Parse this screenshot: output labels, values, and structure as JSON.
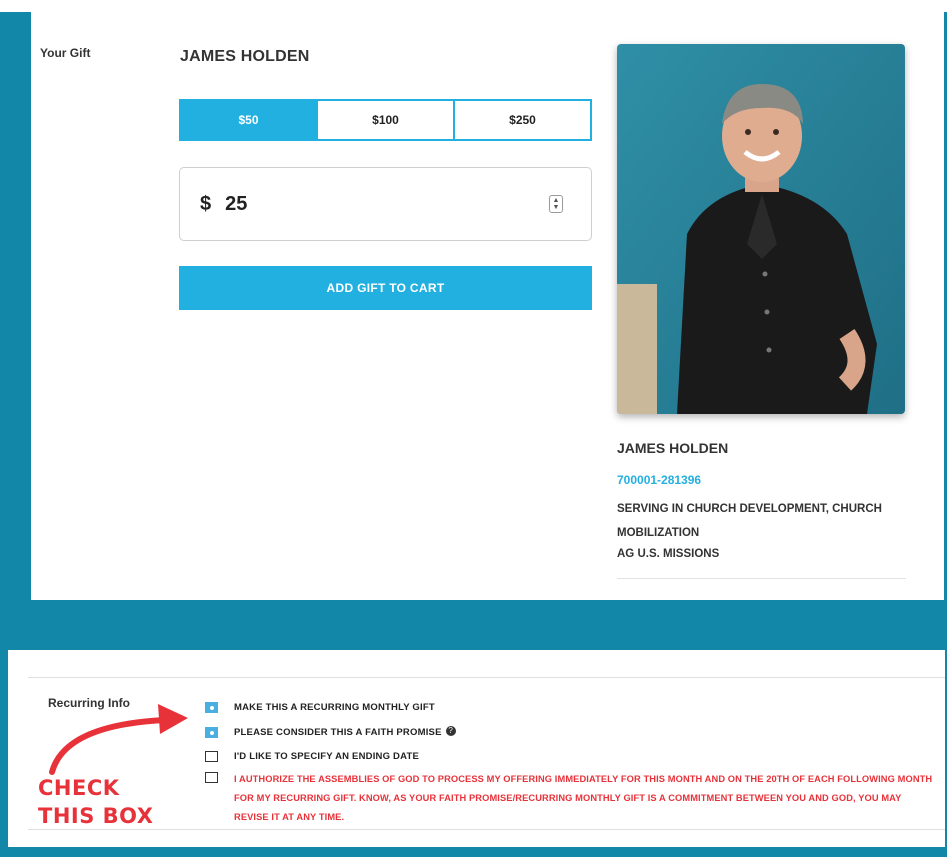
{
  "gift": {
    "section_label": "Your Gift",
    "recipient_name": "JAMES HOLDEN",
    "amount_options": [
      "$50",
      "$100",
      "$250"
    ],
    "selected_option": "$50",
    "currency_symbol": "$",
    "custom_amount": "25",
    "add_to_cart_label": "ADD GIFT TO CART"
  },
  "profile": {
    "name": "JAMES HOLDEN",
    "account_number": "700001-281396",
    "serving": "SERVING IN CHURCH DEVELOPMENT, CHURCH MOBILIZATION",
    "organization": "AG U.S. MISSIONS"
  },
  "recurring": {
    "section_label": "Recurring Info",
    "options": [
      {
        "label": "MAKE THIS A RECURRING MONTHLY GIFT",
        "checked": true
      },
      {
        "label": "PLEASE CONSIDER THIS A FAITH PROMISE",
        "checked": true
      },
      {
        "label": "I'D LIKE TO SPECIFY AN ENDING DATE",
        "checked": false
      }
    ],
    "authorization": {
      "checked": false,
      "text": "I AUTHORIZE THE ASSEMBLIES OF GOD TO PROCESS MY OFFERING IMMEDIATELY FOR THIS MONTH AND ON THE 20TH OF EACH FOLLOWING MONTH FOR MY RECURRING GIFT. KNOW, AS YOUR FAITH PROMISE/RECURRING MONTHLY GIFT IS A COMMITMENT BETWEEN YOU AND GOD, YOU MAY REVISE IT AT ANY TIME."
    }
  },
  "annotation": {
    "callout_line1": "CHECK",
    "callout_line2": "THIS BOX"
  },
  "colors": {
    "accent": "#22b0e0",
    "frame": "#1287a8",
    "warning": "#e8323a"
  }
}
